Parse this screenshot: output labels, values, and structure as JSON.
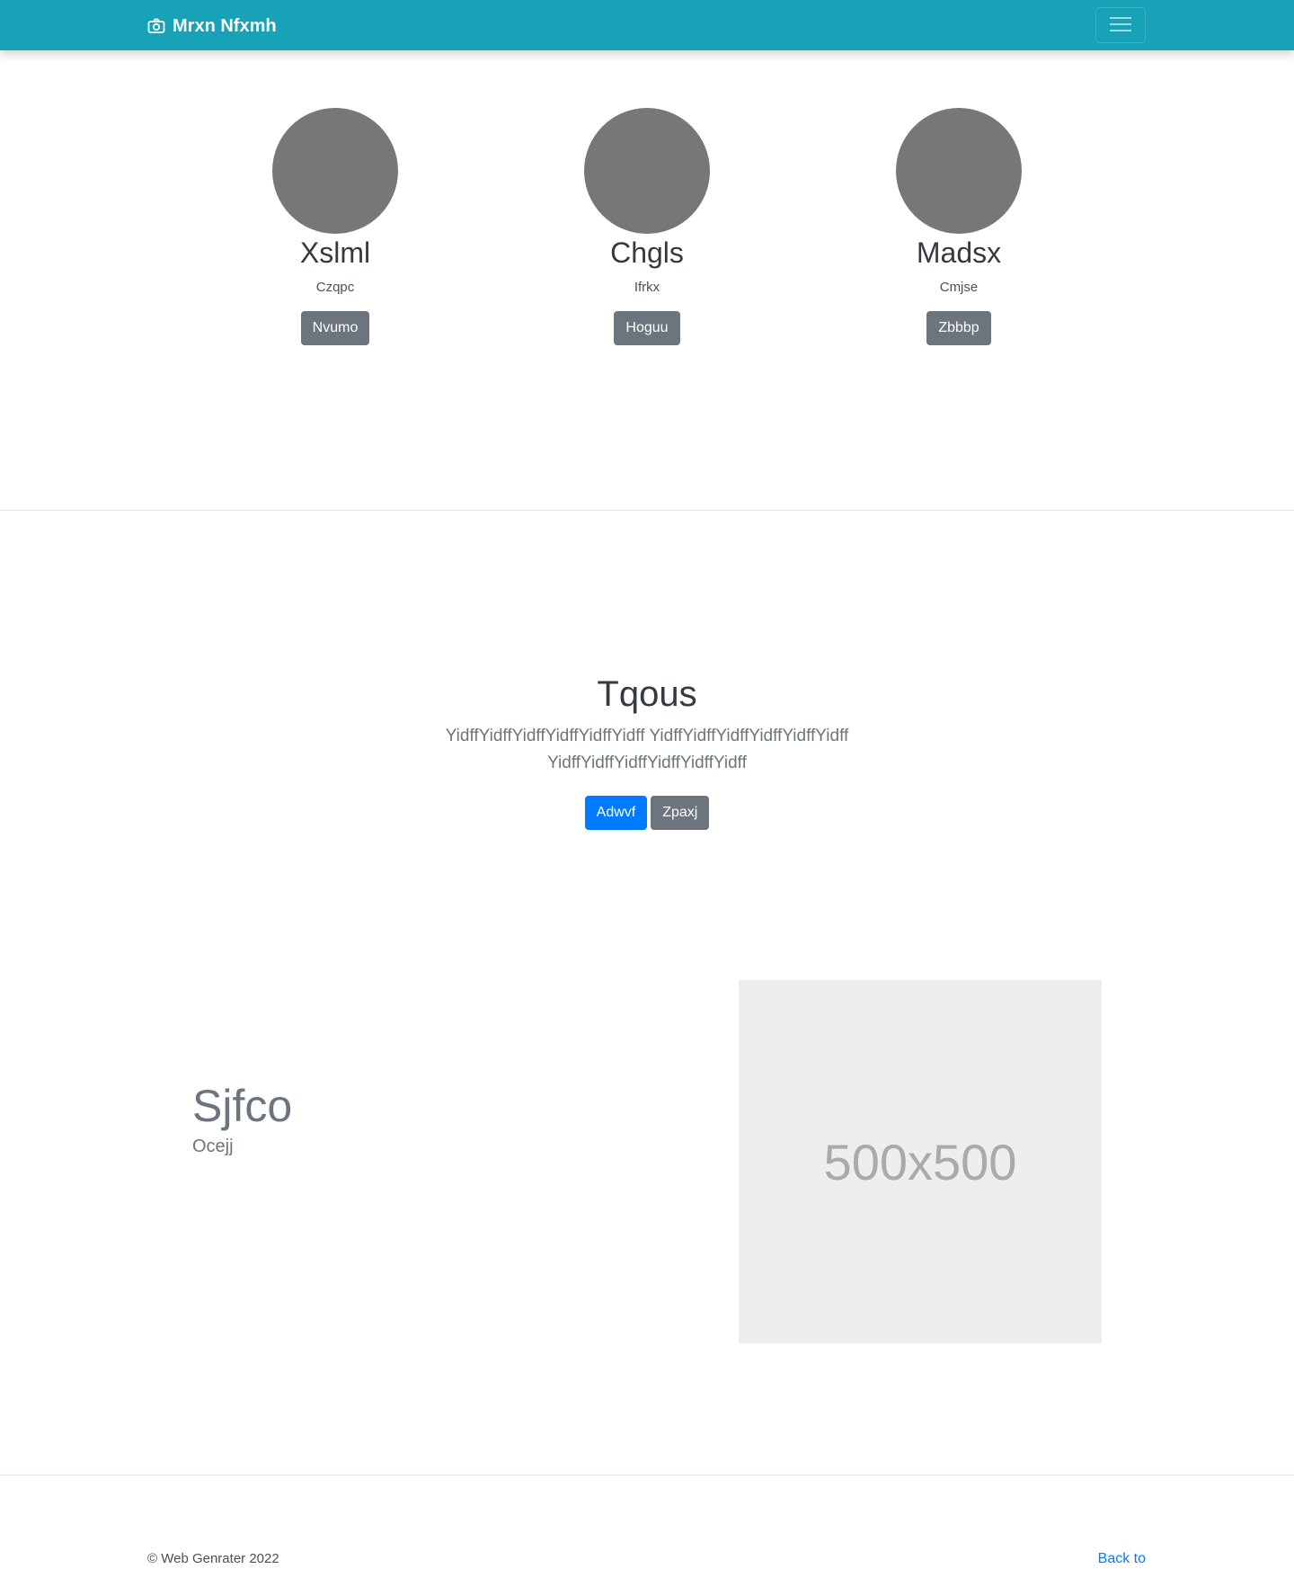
{
  "navbar": {
    "brand": "Mrxn Nfxmh",
    "brand_icon": "camera-icon",
    "toggler_icon": "hamburger-menu-icon",
    "background": "#17a2b8"
  },
  "team": {
    "members": [
      {
        "name": "Xslml",
        "role": "Czqpc",
        "button": "Nvumo"
      },
      {
        "name": "Chgls",
        "role": "Ifrkx",
        "button": "Hoguu"
      },
      {
        "name": "Madsx",
        "role": "Cmjse",
        "button": "Zbbbp"
      }
    ]
  },
  "hero": {
    "title": "Tqous",
    "lead": "YidffYidffYidffYidffYidffYidff YidffYidffYidffYidffYidffYidff YidffYidffYidffYidffYidffYidff",
    "primary_button": "Adwvf",
    "secondary_button": "Zpaxj"
  },
  "feature": {
    "title": "Sjfco",
    "subtitle": "Ocejj",
    "image_label": "500x500"
  },
  "footer": {
    "copyright": "© Web Genrater 2022",
    "back_to_top": "Back to top"
  },
  "colors": {
    "primary": "#007bff",
    "secondary": "#6c757d",
    "avatar": "#777777",
    "placeholder": "#eeeeee"
  }
}
